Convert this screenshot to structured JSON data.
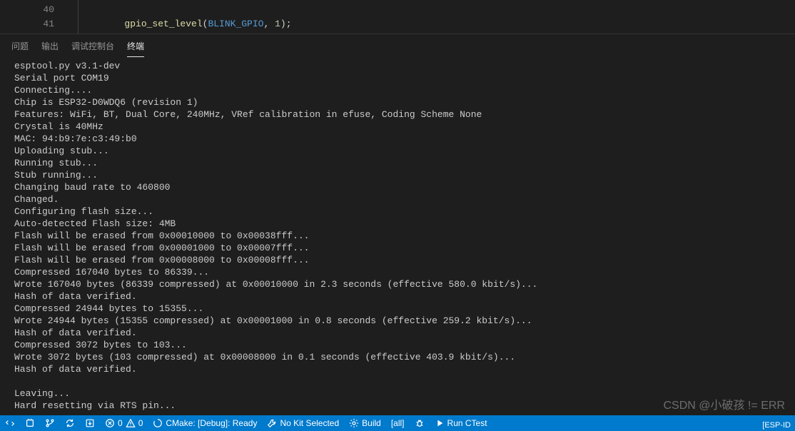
{
  "editor": {
    "lines": [
      {
        "num": "40",
        "code": ""
      },
      {
        "num": "41",
        "indent": "        ",
        "tokens": [
          {
            "t": "gpio_set_level",
            "c": "tok-fn"
          },
          {
            "t": "(",
            "c": "tok-punc"
          },
          {
            "t": "BLINK_GPIO",
            "c": "tok-macro"
          },
          {
            "t": ", ",
            "c": "tok-punc"
          },
          {
            "t": "1",
            "c": "tok-num"
          },
          {
            "t": ");",
            "c": "tok-punc"
          }
        ]
      }
    ]
  },
  "panel": {
    "tabs": [
      {
        "id": "problems",
        "label": "问题",
        "active": false
      },
      {
        "id": "output",
        "label": "输出",
        "active": false
      },
      {
        "id": "debug-console",
        "label": "调试控制台",
        "active": false
      },
      {
        "id": "terminal",
        "label": "终端",
        "active": true
      }
    ],
    "terminal_lines": [
      "esptool.py v3.1-dev",
      "Serial port COM19",
      "Connecting....",
      "Chip is ESP32-D0WDQ6 (revision 1)",
      "Features: WiFi, BT, Dual Core, 240MHz, VRef calibration in efuse, Coding Scheme None",
      "Crystal is 40MHz",
      "MAC: 94:b9:7e:c3:49:b0",
      "Uploading stub...",
      "Running stub...",
      "Stub running...",
      "Changing baud rate to 460800",
      "Changed.",
      "Configuring flash size...",
      "Auto-detected Flash size: 4MB",
      "Flash will be erased from 0x00010000 to 0x00038fff...",
      "Flash will be erased from 0x00001000 to 0x00007fff...",
      "Flash will be erased from 0x00008000 to 0x00008fff...",
      "Compressed 167040 bytes to 86339...",
      "Wrote 167040 bytes (86339 compressed) at 0x00010000 in 2.3 seconds (effective 580.0 kbit/s)...",
      "Hash of data verified.",
      "Compressed 24944 bytes to 15355...",
      "Wrote 24944 bytes (15355 compressed) at 0x00001000 in 0.8 seconds (effective 259.2 kbit/s)...",
      "Hash of data verified.",
      "Compressed 3072 bytes to 103...",
      "Wrote 3072 bytes (103 compressed) at 0x00008000 in 0.1 seconds (effective 403.9 kbit/s)...",
      "Hash of data verified.",
      "",
      "Leaving...",
      "Hard resetting via RTS pin..."
    ]
  },
  "statusbar": {
    "errors": "0",
    "warnings": "0",
    "cmake": "CMake: [Debug]: Ready",
    "kit": "No Kit Selected",
    "build": "Build",
    "target": "[all]",
    "ctest": "Run CTest",
    "esp": "[ESP-ID"
  },
  "watermark": "CSDN @小破孩 != ERR"
}
